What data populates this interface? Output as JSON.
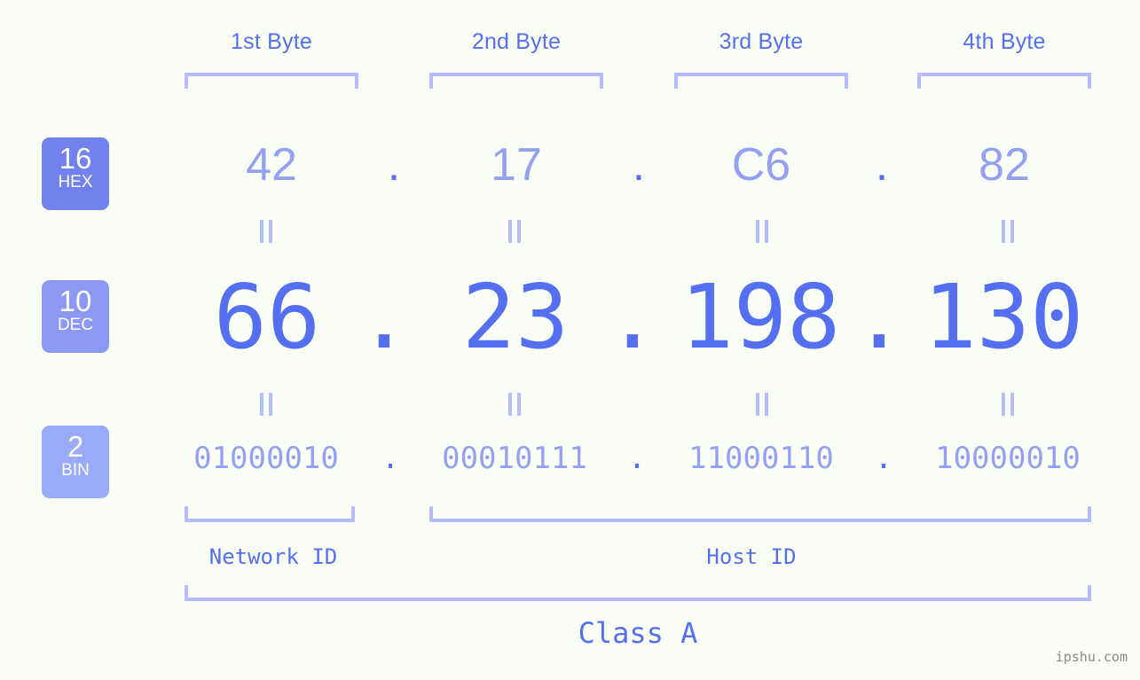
{
  "page": {
    "background_color": "#fbfdf7",
    "accent_color": "#5470f0",
    "muted_accent_color": "#93a1f3",
    "bracket_color": "#b3bdfb",
    "watermark": "ipshu.com"
  },
  "byte_headers": [
    {
      "label": "1st Byte"
    },
    {
      "label": "2nd Byte"
    },
    {
      "label": "3rd Byte"
    },
    {
      "label": "4th Byte"
    }
  ],
  "bases": [
    {
      "number": "16",
      "name": "HEX",
      "color": "#7181ee"
    },
    {
      "number": "10",
      "name": "DEC",
      "color": "#8b99f5"
    },
    {
      "number": "2",
      "name": "BIN",
      "color": "#99aaf8"
    }
  ],
  "rows": {
    "hex": {
      "values": [
        "42",
        "17",
        "C6",
        "82"
      ],
      "separator": "."
    },
    "dec": {
      "values": [
        "66",
        "23",
        "198",
        "130"
      ],
      "separator": "."
    },
    "bin": {
      "values": [
        "01000010",
        "00010111",
        "11000110",
        "10000010"
      ],
      "separator": "."
    }
  },
  "equals_separator": "=",
  "segments": {
    "network_id": "Network ID",
    "host_id": "Host ID",
    "class": "Class A"
  }
}
